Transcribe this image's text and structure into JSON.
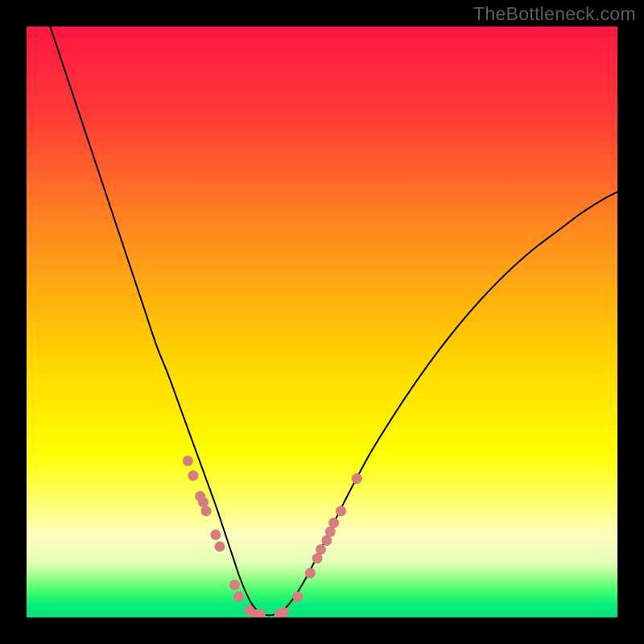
{
  "watermark": "TheBottleneck.com",
  "chart_data": {
    "type": "line",
    "title": "",
    "xlabel": "",
    "ylabel": "",
    "xlim": [
      0,
      100
    ],
    "ylim": [
      0,
      100
    ],
    "background": {
      "type": "vertical_gradient",
      "stops": [
        {
          "offset": 0.0,
          "color": "#ff1643"
        },
        {
          "offset": 0.15,
          "color": "#ff3b35"
        },
        {
          "offset": 0.35,
          "color": "#ff8c1f"
        },
        {
          "offset": 0.55,
          "color": "#ffd000"
        },
        {
          "offset": 0.72,
          "color": "#ffff00"
        },
        {
          "offset": 0.8,
          "color": "#ffff66"
        },
        {
          "offset": 0.86,
          "color": "#ffffbf"
        },
        {
          "offset": 0.905,
          "color": "#e7ffb8"
        },
        {
          "offset": 0.93,
          "color": "#9fff8e"
        },
        {
          "offset": 0.955,
          "color": "#46ff6f"
        },
        {
          "offset": 0.975,
          "color": "#0cf07a"
        },
        {
          "offset": 1.0,
          "color": "#00e37d"
        }
      ]
    },
    "series": [
      {
        "name": "bottleneck-curve",
        "color": "#000000",
        "stroke_width": 2,
        "x": [
          4,
          6,
          8,
          10,
          12,
          14,
          16,
          18,
          20,
          22,
          24,
          26,
          28,
          30,
          32,
          33,
          34,
          35,
          36,
          37,
          38,
          39,
          40,
          42,
          44,
          46,
          48,
          50,
          54,
          58,
          62,
          66,
          70,
          74,
          78,
          82,
          86,
          90,
          94,
          98,
          100
        ],
        "y": [
          100,
          94,
          88,
          82,
          76,
          70,
          64,
          58,
          52,
          46,
          41,
          35.5,
          30,
          24.5,
          19,
          16,
          13,
          10,
          7,
          4.5,
          2.5,
          1.2,
          0.5,
          0.5,
          1.8,
          4.5,
          8,
          12,
          20,
          27.5,
          34,
          40,
          45.5,
          50.5,
          55,
          59,
          62.5,
          65.5,
          68.5,
          71,
          72
        ]
      }
    ],
    "markers": {
      "name": "highlighted-points",
      "color": "#d67d80",
      "radius": 6.5,
      "points": [
        {
          "x": 27.3,
          "y": 26.5
        },
        {
          "x": 28.2,
          "y": 24.0
        },
        {
          "x": 29.4,
          "y": 20.5
        },
        {
          "x": 29.9,
          "y": 19.5
        },
        {
          "x": 30.4,
          "y": 18.0
        },
        {
          "x": 32.0,
          "y": 14.0
        },
        {
          "x": 32.7,
          "y": 12.0
        },
        {
          "x": 35.2,
          "y": 5.5
        },
        {
          "x": 35.9,
          "y": 3.5
        },
        {
          "x": 37.7,
          "y": 1.2
        },
        {
          "x": 38.8,
          "y": 0.5
        },
        {
          "x": 39.6,
          "y": 0.5
        },
        {
          "x": 42.8,
          "y": 0.6
        },
        {
          "x": 43.5,
          "y": 0.9
        },
        {
          "x": 45.9,
          "y": 3.5
        },
        {
          "x": 48.0,
          "y": 7.5
        },
        {
          "x": 49.2,
          "y": 10.0
        },
        {
          "x": 49.8,
          "y": 11.5
        },
        {
          "x": 50.8,
          "y": 13.0
        },
        {
          "x": 51.4,
          "y": 14.5
        },
        {
          "x": 52.0,
          "y": 16.0
        },
        {
          "x": 53.2,
          "y": 18.0
        },
        {
          "x": 55.9,
          "y": 23.5
        }
      ]
    }
  }
}
